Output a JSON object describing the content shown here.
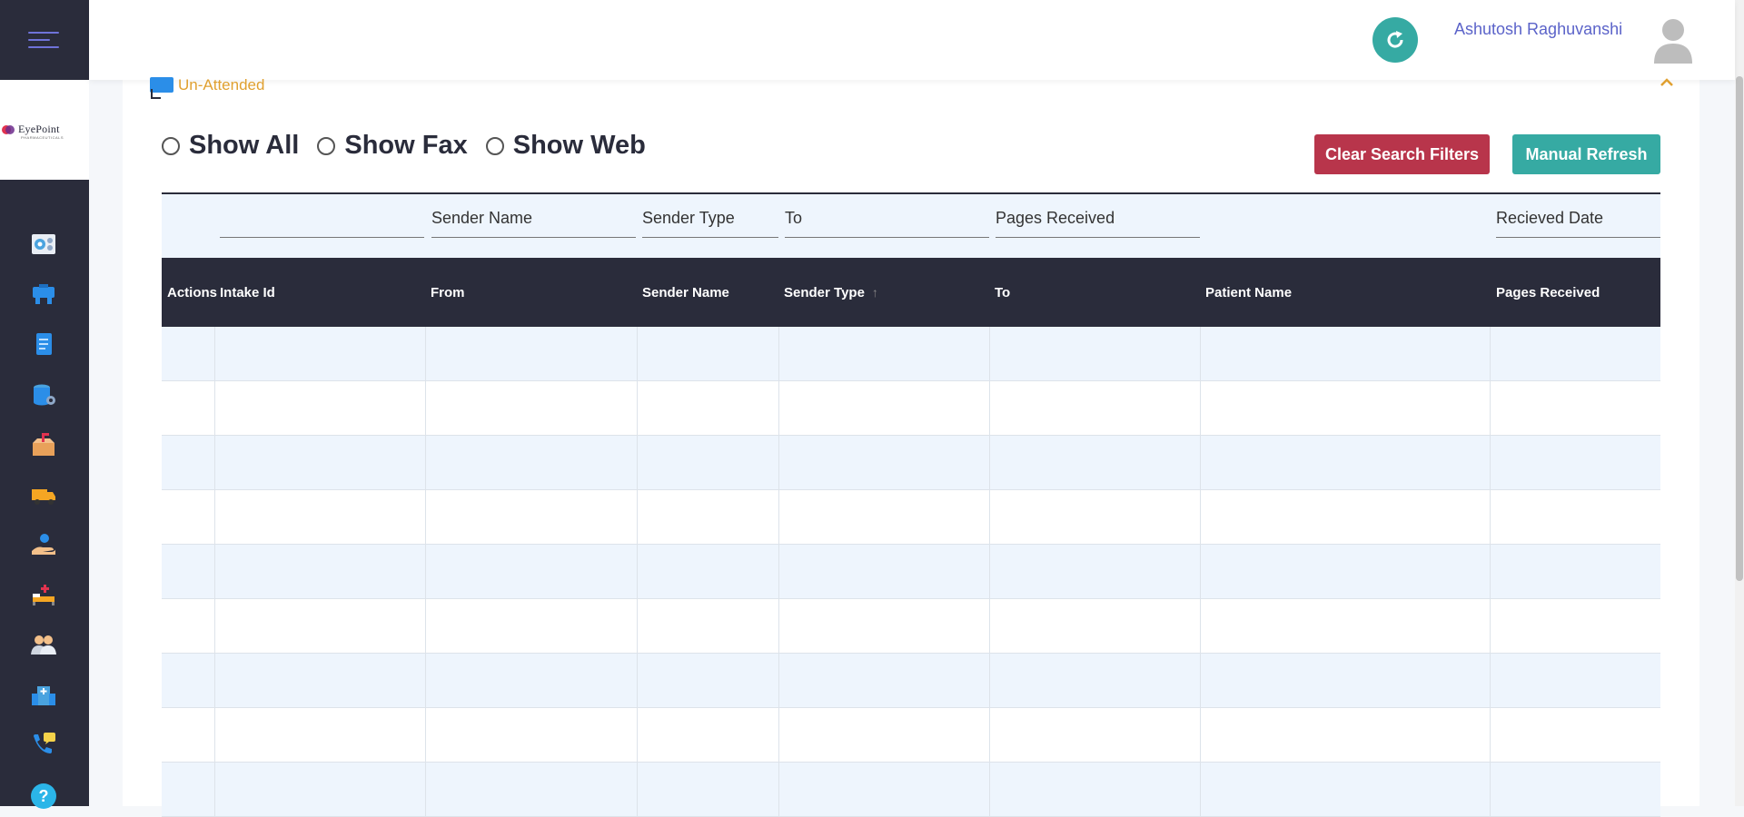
{
  "header": {
    "user_name": "Ashutosh Raghuvanshi"
  },
  "logo": {
    "brand_text": "EyePoint",
    "sub_text": "PHARMACEUTICALS"
  },
  "sidebar": {
    "items": [
      {
        "icon": "dashboard-icon"
      },
      {
        "icon": "inbox-icon"
      },
      {
        "icon": "document-icon"
      },
      {
        "icon": "database-settings-icon"
      },
      {
        "icon": "package-icon"
      },
      {
        "icon": "delivery-truck-icon"
      },
      {
        "icon": "hand-care-icon"
      },
      {
        "icon": "hospital-bed-icon"
      },
      {
        "icon": "users-icon"
      },
      {
        "icon": "hospital-building-icon"
      },
      {
        "icon": "phone-chat-icon"
      },
      {
        "icon": "help-icon"
      }
    ]
  },
  "section": {
    "title": "Un-Attended"
  },
  "filters_radio": {
    "options": [
      "Show All",
      "Show Fax",
      "Show Web"
    ]
  },
  "buttons": {
    "clear_filters": "Clear Search Filters",
    "manual_refresh": "Manual Refresh"
  },
  "filter_bar": {
    "fields": [
      {
        "label": ""
      },
      {
        "label": "Sender Name"
      },
      {
        "label": "Sender Type"
      },
      {
        "label": "To"
      },
      {
        "label": "Pages Received"
      },
      {
        "label": "Recieved Date"
      }
    ]
  },
  "table": {
    "columns": [
      "Actions",
      "Intake Id",
      "From",
      "Sender Name",
      "Sender Type",
      "To",
      "Patient Name",
      "Pages Received"
    ],
    "sort_column": "Sender Type",
    "rows_visible": 9
  },
  "colors": {
    "sidebar_bg": "#2a2c3b",
    "accent_teal": "#36aaa3",
    "accent_red": "#b8354b",
    "section_title": "#e0a030",
    "user_name": "#5b63c9"
  }
}
